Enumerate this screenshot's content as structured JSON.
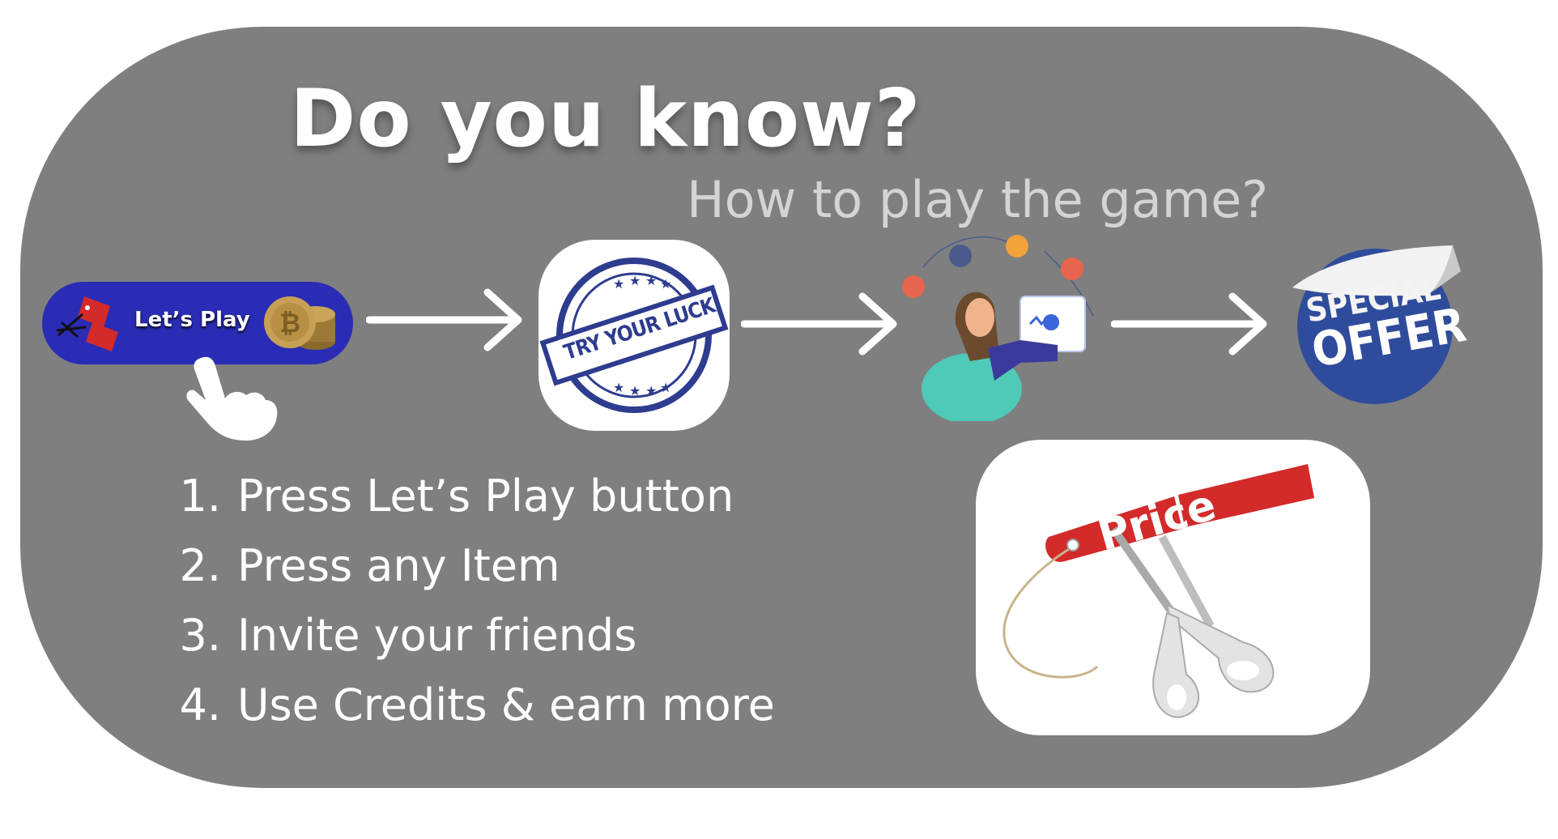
{
  "header": {
    "title": "Do you know?",
    "subtitle": "How to play the game?"
  },
  "lets_play": {
    "label": "Let’s Play"
  },
  "luck_stamp": {
    "top_text": "TRY YOUR LUCK"
  },
  "offer_sticker": {
    "line1": "SPECIAL",
    "line2": "OFFER"
  },
  "price_tag": {
    "text": "Price"
  },
  "steps": [
    {
      "num": "1.",
      "text": "Press Let’s Play button"
    },
    {
      "num": "2.",
      "text": "Press any Item"
    },
    {
      "num": "3.",
      "text": "Invite your friends"
    },
    {
      "num": "4.",
      "text": "Use Credits & earn more"
    }
  ],
  "colors": {
    "panel": "#7f7f7f",
    "lets_play_bg": "#2a2cb5",
    "stamp_blue": "#2e3c8f",
    "sticker_blue": "#2f4c9c",
    "tag_red": "#d32a2a"
  }
}
